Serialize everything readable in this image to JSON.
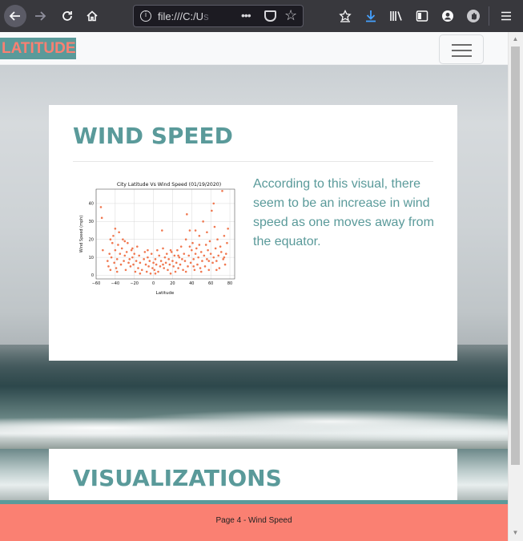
{
  "browser": {
    "url_text": "file:///C:/U",
    "url_faded": "s"
  },
  "page": {
    "brand": "LATITUDE",
    "card1": {
      "title": "WIND SPEED",
      "description": "According to this visual, there seem to be an increase in wind speed as one moves away from the equator."
    },
    "card2": {
      "title": "VISUALIZATIONS"
    },
    "footer": "Page 4 - Wind Speed"
  },
  "colors": {
    "accent": "#5a9a9a",
    "salmon": "#fa8072",
    "point": "#f07850"
  },
  "chart_data": {
    "type": "scatter",
    "title": "City Latitude Vs Wind Speed (01/19/2020)",
    "xlabel": "Latitude",
    "ylabel": "Wind Speed (mph)",
    "xlim": [
      -60,
      85
    ],
    "ylim": [
      -2,
      48
    ],
    "xticks": [
      -60,
      -40,
      -20,
      0,
      20,
      40,
      60,
      80
    ],
    "yticks": [
      0,
      10,
      20,
      30,
      40
    ],
    "grid": true,
    "points": [
      [
        -55,
        38
      ],
      [
        -54,
        32
      ],
      [
        -48,
        8
      ],
      [
        -47,
        5
      ],
      [
        -46,
        12
      ],
      [
        -45,
        3
      ],
      [
        -44,
        10
      ],
      [
        -43,
        18
      ],
      [
        -42,
        22
      ],
      [
        -41,
        7
      ],
      [
        -40,
        26
      ],
      [
        -40,
        14
      ],
      [
        -39,
        4
      ],
      [
        -38,
        9
      ],
      [
        -37,
        17
      ],
      [
        -36,
        24
      ],
      [
        -35,
        12
      ],
      [
        -34,
        6
      ],
      [
        -33,
        15
      ],
      [
        -32,
        20
      ],
      [
        -31,
        8
      ],
      [
        -30,
        11
      ],
      [
        -29,
        3
      ],
      [
        -28,
        13
      ],
      [
        -27,
        18
      ],
      [
        -26,
        7
      ],
      [
        -25,
        9
      ],
      [
        -24,
        5
      ],
      [
        -23,
        14
      ],
      [
        -22,
        10
      ],
      [
        -21,
        6
      ],
      [
        -20,
        12
      ],
      [
        -19,
        2
      ],
      [
        -18,
        8
      ],
      [
        -17,
        16
      ],
      [
        -16,
        4
      ],
      [
        -15,
        11
      ],
      [
        -14,
        7
      ],
      [
        -12,
        3
      ],
      [
        -10,
        9
      ],
      [
        -9,
        13
      ],
      [
        -8,
        6
      ],
      [
        -7,
        2
      ],
      [
        -6,
        10
      ],
      [
        -5,
        5
      ],
      [
        -4,
        8
      ],
      [
        -3,
        1
      ],
      [
        -2,
        12
      ],
      [
        -1,
        4
      ],
      [
        0,
        7
      ],
      [
        1,
        3
      ],
      [
        2,
        9
      ],
      [
        3,
        6
      ],
      [
        4,
        14
      ],
      [
        5,
        2
      ],
      [
        6,
        11
      ],
      [
        7,
        5
      ],
      [
        8,
        8
      ],
      [
        9,
        25
      ],
      [
        10,
        15
      ],
      [
        11,
        4
      ],
      [
        12,
        10
      ],
      [
        13,
        7
      ],
      [
        14,
        12
      ],
      [
        15,
        3
      ],
      [
        16,
        9
      ],
      [
        17,
        6
      ],
      [
        18,
        1
      ],
      [
        19,
        13
      ],
      [
        20,
        8
      ],
      [
        21,
        5
      ],
      [
        22,
        11
      ],
      [
        23,
        2
      ],
      [
        24,
        7
      ],
      [
        25,
        14
      ],
      [
        26,
        4
      ],
      [
        27,
        10
      ],
      [
        28,
        6
      ],
      [
        29,
        16
      ],
      [
        30,
        9
      ],
      [
        31,
        3
      ],
      [
        32,
        12
      ],
      [
        33,
        8
      ],
      [
        34,
        20
      ],
      [
        35,
        34
      ],
      [
        36,
        5
      ],
      [
        37,
        11
      ],
      [
        38,
        25
      ],
      [
        39,
        7
      ],
      [
        40,
        14
      ],
      [
        41,
        18
      ],
      [
        42,
        9
      ],
      [
        43,
        3
      ],
      [
        44,
        12
      ],
      [
        45,
        15
      ],
      [
        46,
        6
      ],
      [
        47,
        10
      ],
      [
        48,
        22
      ],
      [
        49,
        4
      ],
      [
        50,
        13
      ],
      [
        51,
        8
      ],
      [
        52,
        30
      ],
      [
        53,
        11
      ],
      [
        54,
        5
      ],
      [
        55,
        17
      ],
      [
        56,
        9
      ],
      [
        57,
        14
      ],
      [
        58,
        3
      ],
      [
        59,
        19
      ],
      [
        60,
        12
      ],
      [
        61,
        36
      ],
      [
        62,
        7
      ],
      [
        63,
        10
      ],
      [
        64,
        27
      ],
      [
        65,
        15
      ],
      [
        66,
        8
      ],
      [
        67,
        20
      ],
      [
        68,
        11
      ],
      [
        69,
        4
      ],
      [
        70,
        16
      ],
      [
        71,
        13
      ],
      [
        72,
        47
      ],
      [
        73,
        9
      ],
      [
        74,
        22
      ],
      [
        75,
        6
      ],
      [
        76,
        12
      ],
      [
        77,
        18
      ],
      [
        78,
        26
      ],
      [
        -53,
        14
      ],
      [
        -45,
        20
      ],
      [
        -38,
        2
      ],
      [
        -30,
        19
      ],
      [
        -22,
        15
      ],
      [
        -14,
        1
      ],
      [
        -6,
        14
      ],
      [
        2,
        1
      ],
      [
        10,
        6
      ],
      [
        18,
        14
      ],
      [
        26,
        11
      ],
      [
        34,
        2
      ],
      [
        42,
        5
      ],
      [
        50,
        2
      ],
      [
        58,
        8
      ],
      [
        66,
        3
      ],
      [
        74,
        10
      ],
      [
        44,
        25
      ],
      [
        56,
        24
      ],
      [
        63,
        40
      ],
      [
        48,
        17
      ],
      [
        38,
        16
      ]
    ]
  }
}
